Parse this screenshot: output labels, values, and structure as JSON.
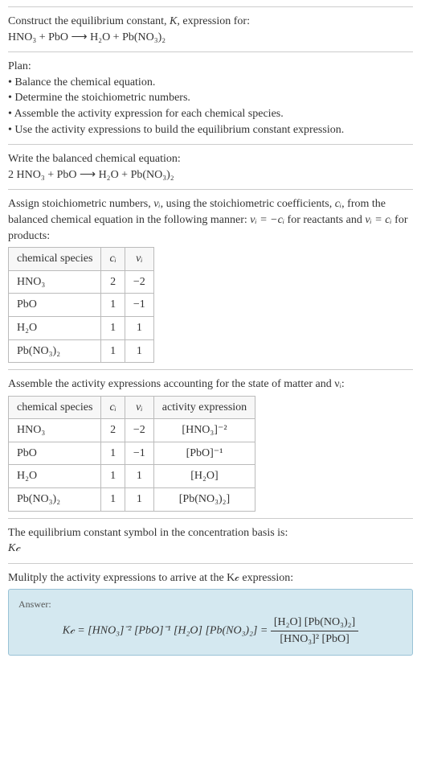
{
  "title1": "Construct the equilibrium constant, ",
  "title2": ", expression for:",
  "K": "K",
  "equation_unbalanced": "HNO₃ + PbO  ⟶  H₂O + Pb(NO₃)₂",
  "plan_heading": "Plan:",
  "plan_items": [
    "• Balance the chemical equation.",
    "• Determine the stoichiometric numbers.",
    "• Assemble the activity expression for each chemical species.",
    "• Use the activity expressions to build the equilibrium constant expression."
  ],
  "balanced_heading": "Write the balanced chemical equation:",
  "equation_balanced": "2 HNO₃ + PbO  ⟶  H₂O + Pb(NO₃)₂",
  "stoich_intro1": "Assign stoichiometric numbers, ",
  "stoich_intro2": ", using the stoichiometric coefficients, ",
  "stoich_intro3": ", from the balanced chemical equation in the following manner: ",
  "stoich_intro4": " for reactants and ",
  "stoich_intro5": " for products:",
  "nu_i": "νᵢ",
  "c_i": "cᵢ",
  "rel_react": "νᵢ = −cᵢ",
  "rel_prod": "νᵢ = cᵢ",
  "stoich_table": {
    "headers": [
      "chemical species",
      "cᵢ",
      "νᵢ"
    ],
    "rows": [
      [
        "HNO₃",
        "2",
        "−2"
      ],
      [
        "PbO",
        "1",
        "−1"
      ],
      [
        "H₂O",
        "1",
        "1"
      ],
      [
        "Pb(NO₃)₂",
        "1",
        "1"
      ]
    ]
  },
  "activity_heading": "Assemble the activity expressions accounting for the state of matter and νᵢ:",
  "activity_table": {
    "headers": [
      "chemical species",
      "cᵢ",
      "νᵢ",
      "activity expression"
    ],
    "rows": [
      [
        "HNO₃",
        "2",
        "−2",
        "[HNO₃]⁻²"
      ],
      [
        "PbO",
        "1",
        "−1",
        "[PbO]⁻¹"
      ],
      [
        "H₂O",
        "1",
        "1",
        "[H₂O]"
      ],
      [
        "Pb(NO₃)₂",
        "1",
        "1",
        "[Pb(NO₃)₂]"
      ]
    ]
  },
  "kc_heading": "The equilibrium constant symbol in the concentration basis is:",
  "kc_symbol": "K𝒸",
  "multiply_heading": "Mulitply the activity expressions to arrive at the K𝒸 expression:",
  "answer_label": "Answer:",
  "answer_left": "K𝒸 = [HNO₃]⁻² [PbO]⁻¹ [H₂O] [Pb(NO₃)₂] = ",
  "answer_num": "[H₂O] [Pb(NO₃)₂]",
  "answer_den": "[HNO₃]² [PbO]"
}
